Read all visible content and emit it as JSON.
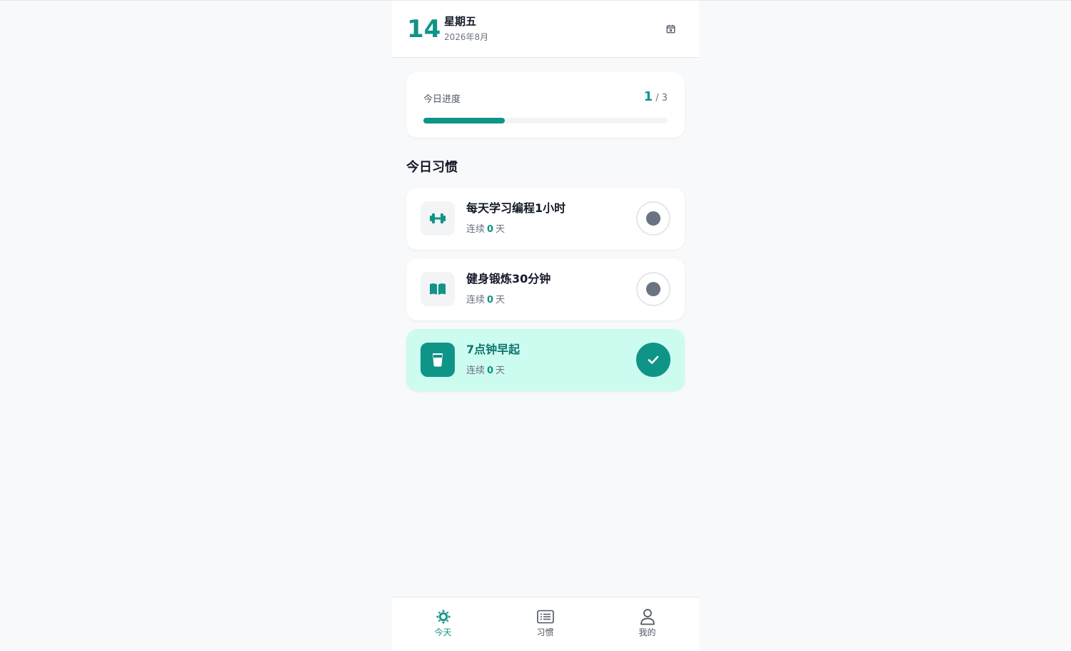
{
  "header": {
    "day": "14",
    "weekday": "星期五",
    "month": "2026年8月",
    "calendar_icon": "calendar-x-icon"
  },
  "progress": {
    "label": "今日进度",
    "done": "1",
    "total": "/ 3",
    "fraction": 0.333
  },
  "section_title": "今日习惯",
  "habits": [
    {
      "name": "每天学习编程1小时",
      "streak_prefix": "连续",
      "streak": "0",
      "streak_suffix": "天",
      "icon": "dumbbell-icon",
      "done": false
    },
    {
      "name": "健身锻炼30分钟",
      "streak_prefix": "连续",
      "streak": "0",
      "streak_suffix": "天",
      "icon": "book-open-icon",
      "done": false
    },
    {
      "name": "7点钟早起",
      "streak_prefix": "连续",
      "streak": "0",
      "streak_suffix": "天",
      "icon": "cup-icon",
      "done": true
    }
  ],
  "nav": [
    {
      "label": "今天",
      "icon": "sun-icon",
      "active": true
    },
    {
      "label": "习惯",
      "icon": "list-icon",
      "active": false
    },
    {
      "label": "我的",
      "icon": "user-icon",
      "active": false
    }
  ],
  "colors": {
    "accent": "#0f9488",
    "done_card": "#ccfbef",
    "background": "#f8f9fb"
  }
}
